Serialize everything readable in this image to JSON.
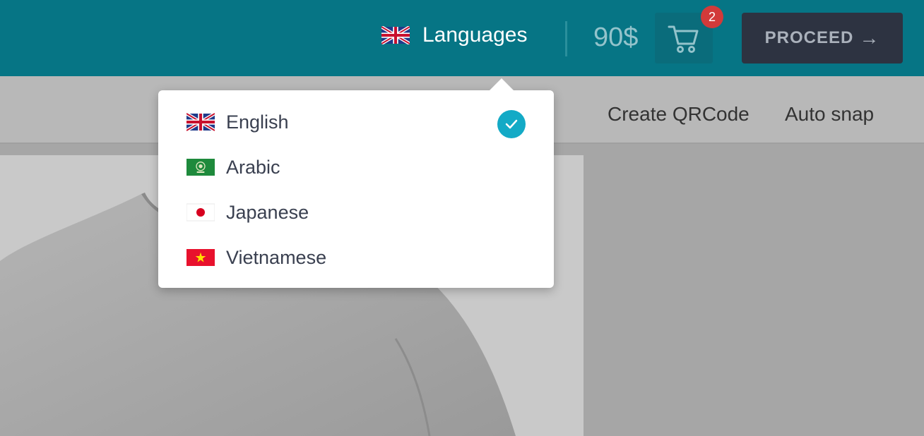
{
  "header": {
    "language_label": "Languages",
    "price": "90$",
    "cart_count": "2",
    "proceed_label": "PROCEED",
    "proceed_arrow": "→",
    "accent_color": "#067585"
  },
  "toolbar": {
    "items": [
      {
        "label": "Create QRCode"
      },
      {
        "label": "Auto snap"
      }
    ]
  },
  "language_menu": {
    "selected": "English",
    "options": [
      {
        "name": "English",
        "flag": "uk-flag-icon",
        "selected": true
      },
      {
        "name": "Arabic",
        "flag": "arab-league-flag-icon",
        "selected": false
      },
      {
        "name": "Japanese",
        "flag": "japan-flag-icon",
        "selected": false
      },
      {
        "name": "Vietnamese",
        "flag": "vietnam-flag-icon",
        "selected": false
      }
    ],
    "check_color": "#13aac6"
  }
}
